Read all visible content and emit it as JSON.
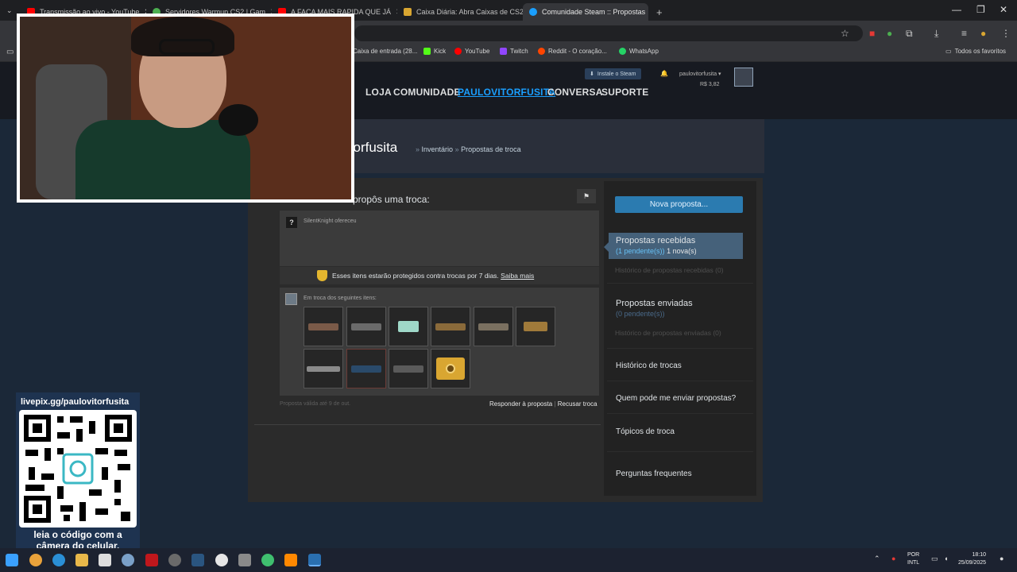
{
  "browser": {
    "tabs": [
      {
        "title": "Transmissão ao vivo - YouTube",
        "color": "#ff0000"
      },
      {
        "title": "Servidores Warmup CS2 | Gam",
        "color": "#4caf50"
      },
      {
        "title": "A FACA MAIS RAPIDA QUE JÁ",
        "color": "#ff0000"
      },
      {
        "title": "Caixa Diária: Abra Caixas de CS2",
        "color": "#d9a631"
      },
      {
        "title": "Comunidade Steam :: Propostas",
        "color": "#1a9fff"
      }
    ],
    "new_tab": "+",
    "bookmarks": [
      {
        "label": "Caixa de entrada (28...",
        "color": "#c5221f"
      },
      {
        "label": "Kick",
        "color": "#53fc18"
      },
      {
        "label": "YouTube",
        "color": "#ff0000"
      },
      {
        "label": "Twitch",
        "color": "#9146ff"
      },
      {
        "label": "Reddit - O coração...",
        "color": "#ff4500"
      },
      {
        "label": "WhatsApp",
        "color": "#25d366"
      }
    ],
    "all_bookmarks": "Todos os favoritos"
  },
  "steam": {
    "install_label": "Instale o Steam",
    "account_name": "paulovitorfusita",
    "wallet": "R$ 3,82",
    "nav": [
      "LOJA",
      "COMUNIDADE",
      "PAULOVITORFUSITA",
      "CONVERSA",
      "SUPORTE"
    ],
    "page_name": "itorfusita",
    "breadcrumb_sep": "»",
    "breadcrumb_1": "Inventário",
    "breadcrumb_2": "Propostas de troca"
  },
  "offer": {
    "title": "propôs uma troca:",
    "partner_offered": "SilentKnight ofereceu",
    "protection_text": "Esses itens estarão protegidos contra trocas por 7 dias.",
    "learn_more": "Saiba mais",
    "exchange_label": "Em troca dos seguintes itens:",
    "validity": "Proposta válida até 9 de out.",
    "respond": "Responder à proposta",
    "sep": "|",
    "decline": "Recusar troca",
    "items_row1": [
      {
        "icon": "rifle-icon",
        "color": "#7a5a48"
      },
      {
        "icon": "rifle-icon",
        "color": "#6a6a6a"
      },
      {
        "icon": "pistol-icon",
        "color": "#9fd8c8"
      },
      {
        "icon": "rifle-icon",
        "color": "#8a6a3a"
      },
      {
        "icon": "rifle-icon",
        "color": "#7a7060"
      },
      {
        "icon": "smg-icon",
        "color": "#a07a3a"
      }
    ],
    "items_row2": [
      {
        "icon": "sniper-icon",
        "color": "#8a8a8a"
      },
      {
        "icon": "rifle-icon",
        "color": "#2a4a6a"
      },
      {
        "icon": "rifle-icon",
        "color": "#5a5a5a"
      },
      {
        "icon": "case-icon",
        "color": "#d9a631"
      }
    ]
  },
  "sidebar": {
    "new_offer": "Nova proposta...",
    "received": "Propostas recebidas",
    "received_pending": "(1 pendente(s))",
    "received_new": "1 nova(s)",
    "received_history": "Histórico de propostas recebidas (0)",
    "sent": "Propostas enviadas",
    "sent_pending": "(0 pendente(s))",
    "sent_history": "Histórico de propostas enviadas (0)",
    "trade_history": "Histórico de trocas",
    "who_can_send": "Quem pode me enviar propostas?",
    "trade_topics": "Tópicos de troca",
    "faq": "Perguntas frequentes"
  },
  "overlay": {
    "livepix_url": "livepix.gg/paulovitorfusita",
    "qr_caption_1": "leia o código com a",
    "qr_caption_2": "câmera do celular."
  },
  "taskbar": {
    "lang_1": "POR",
    "lang_2": "INTL",
    "time": "18:10",
    "date": "25/09/2025"
  }
}
